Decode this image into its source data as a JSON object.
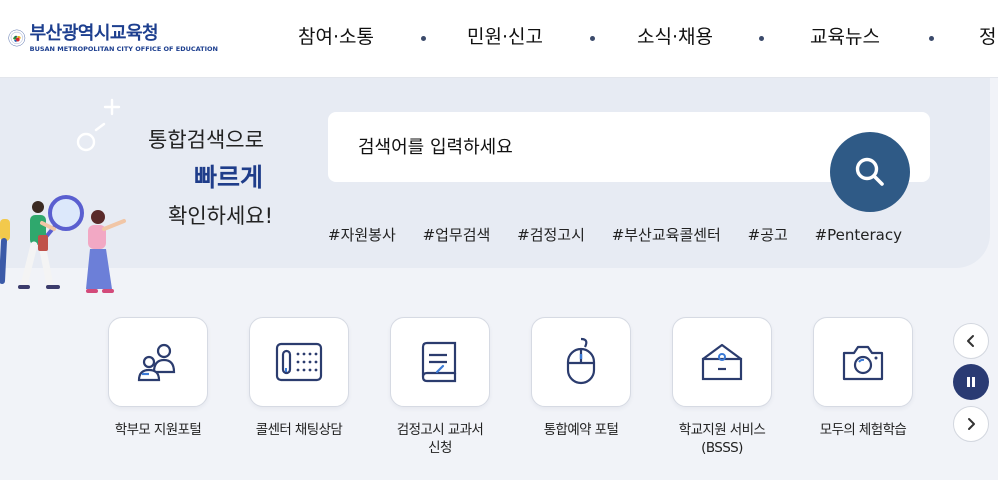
{
  "header": {
    "logo": {
      "name_ko": "부산광역시교육청",
      "name_en": "BUSAN METROPOLITAN CITY OFFICE OF EDUCATION",
      "emblem_ring_text": "부산광역시교육청",
      "emblem_ring_text_en": "METROPOLITAN CITY OFFICE OF EDUCATION"
    },
    "nav": [
      {
        "label": "참여·소통"
      },
      {
        "label": "민원·신고"
      },
      {
        "label": "소식·채용"
      },
      {
        "label": "교육뉴스"
      },
      {
        "label": "정"
      }
    ]
  },
  "search": {
    "tagline_1": "통합검색으로",
    "tagline_2": "빠르게",
    "tagline_3": "확인하세요!",
    "placeholder": "검색어를 입력하세요",
    "button_icon": "search-icon",
    "keywords": [
      "#자원봉사",
      "#업무검색",
      "#검정고시",
      "#부산교육콜센터",
      "#공고",
      "#Penteracy"
    ]
  },
  "quick_menu": [
    {
      "label": "학부모 지원포털",
      "icon": "parents-icon"
    },
    {
      "label": "콜센터 채팅상담",
      "icon": "chat-keypad-icon"
    },
    {
      "label": "검정고시 교과서\n신청",
      "icon": "book-icon"
    },
    {
      "label": "통합예약 포털",
      "icon": "mouse-icon"
    },
    {
      "label": "학교지원 서비스\n(BSSS)",
      "icon": "school-service-icon"
    },
    {
      "label": "모두의 체험학습",
      "icon": "camera-icon"
    }
  ],
  "controls": {
    "prev_icon": "chevron-left-icon",
    "pause_icon": "pause-icon",
    "next_icon": "chevron-right-icon"
  },
  "colors": {
    "brand_blue": "#1d3f8f",
    "search_button": "#2f5a86",
    "band_bg": "#e7ebf3",
    "page_bg": "#f1f3f8",
    "pause_button": "#2a3b73"
  }
}
